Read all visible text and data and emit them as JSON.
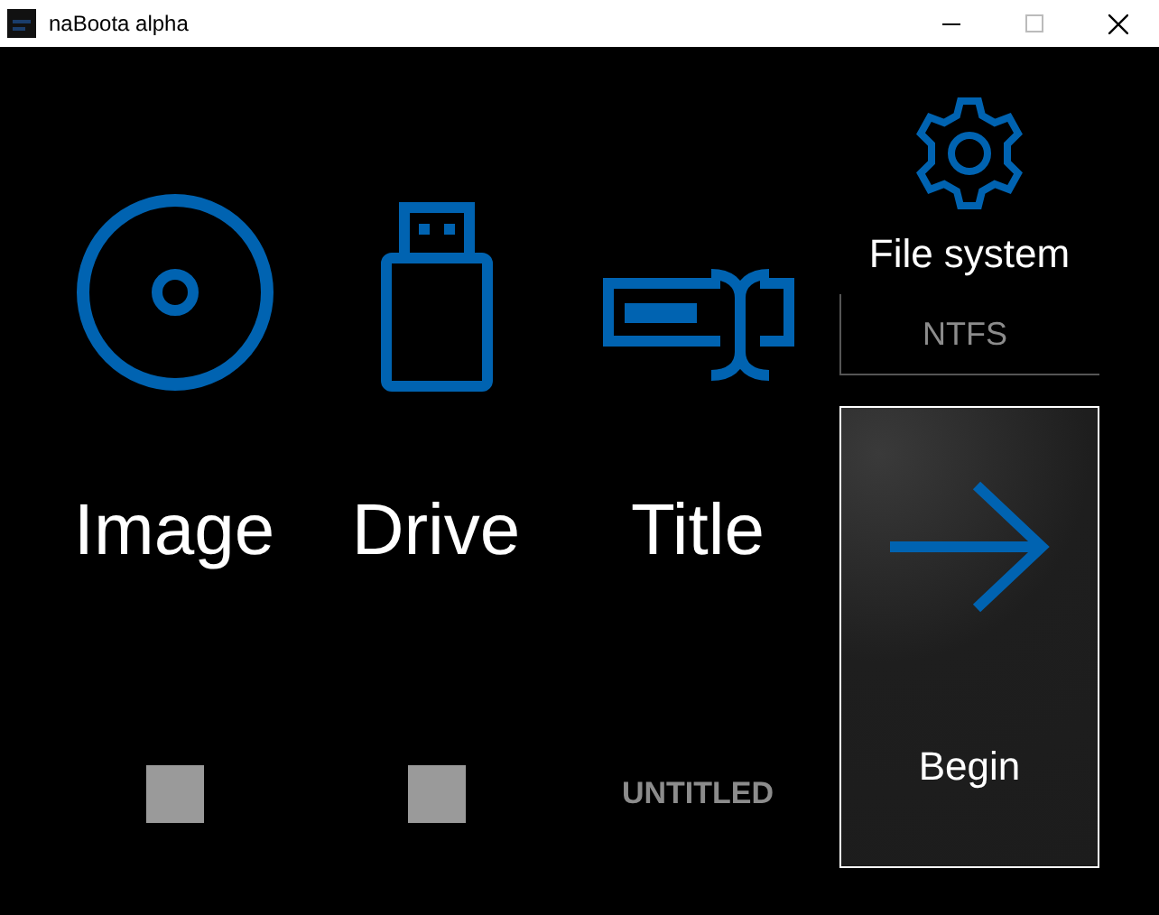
{
  "window": {
    "title": "naBoota alpha"
  },
  "columns": [
    {
      "kind": "disc",
      "label": "Image",
      "footer": {
        "kind": "square"
      }
    },
    {
      "kind": "usb",
      "label": "Drive",
      "footer": {
        "kind": "square"
      }
    },
    {
      "kind": "title",
      "label": "Title",
      "footer": {
        "kind": "text",
        "text": "UNTITLED"
      }
    }
  ],
  "file_system": {
    "label": "File system",
    "value": "NTFS"
  },
  "begin_button": {
    "label": "Begin"
  }
}
